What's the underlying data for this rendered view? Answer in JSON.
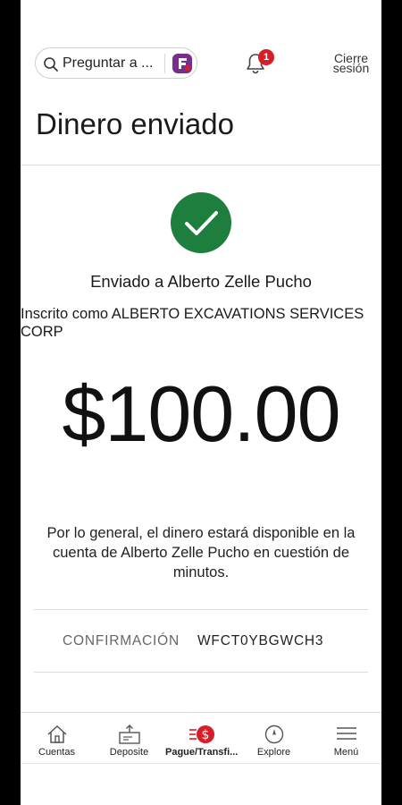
{
  "header": {
    "search_placeholder": "Preguntar a ...",
    "notification_count": "1",
    "signout_line1": "Cierre",
    "signout_line2": "sesión"
  },
  "page": {
    "title": "Dinero enviado"
  },
  "confirmation": {
    "sent_to": "Enviado a Alberto Zelle Pucho",
    "enrolled_as_line1": "Inscrito como ALBERTO EXCAVATIONS SERVICES",
    "enrolled_as_line2": "CORP",
    "amount": "$100.00",
    "note_line1": "Por lo general, el dinero estará disponible en la",
    "note_line2": "cuenta de Alberto Zelle Pucho en cuestión de",
    "note_line3": "minutos.",
    "label": "CONFIRMACIÓN",
    "code": "WFCT0YBGWCH3"
  },
  "nav": {
    "items": [
      {
        "label": "Cuentas",
        "icon": "home-icon"
      },
      {
        "label": "Deposite",
        "icon": "deposit-icon"
      },
      {
        "label": "Pague/Transfi...",
        "icon": "pay-transfer-icon"
      },
      {
        "label": "Explore",
        "icon": "compass-icon"
      },
      {
        "label": "Menú",
        "icon": "menu-icon"
      }
    ],
    "active_index": 2
  },
  "colors": {
    "success_green": "#1e7e3e",
    "brand_red": "#d71e28",
    "fargo_purple": "#7a2d8c"
  }
}
